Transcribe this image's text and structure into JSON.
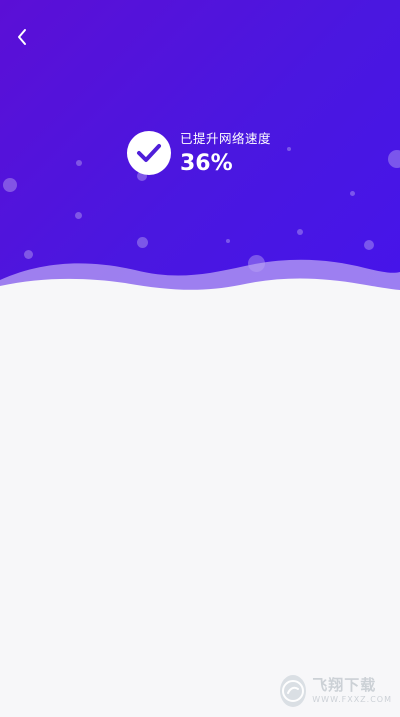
{
  "header": {
    "back_icon": "chevron-left-icon",
    "check_icon": "check-circle-icon",
    "status_label": "已提升网络速度",
    "status_percent": "36%"
  },
  "watermark": {
    "main_text": "飞翔下载",
    "sub_text": "WWW.FXXZ.COM",
    "logo_icon": "circle-logo-icon"
  },
  "colors": {
    "header_gradient_start": "#5b0fd6",
    "header_gradient_end": "#4614ea",
    "content_background": "#f7f7f9",
    "check_color": "#4f1ed9"
  }
}
